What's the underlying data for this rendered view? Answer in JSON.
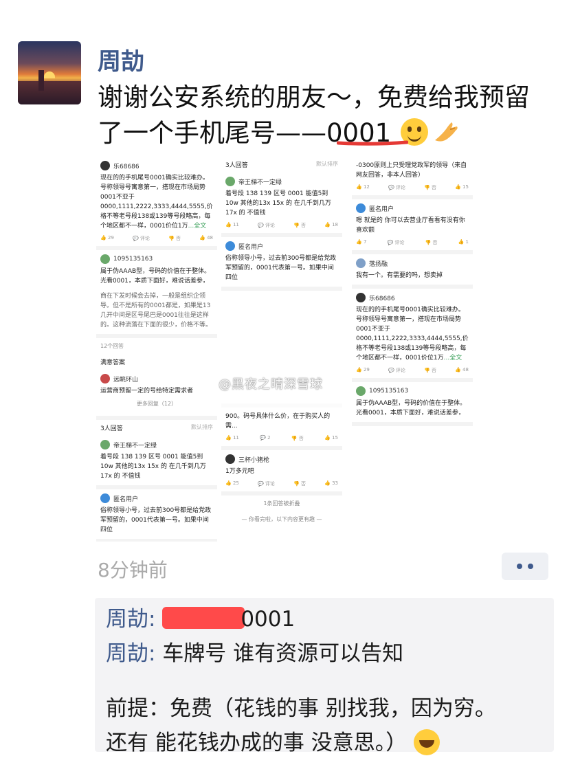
{
  "post": {
    "author": "周劼",
    "text_line1": "谢谢公安系统的朋友～，免费给我预留",
    "text_line2": "了一个手机尾号——0001",
    "time": "8分钟前"
  },
  "screens": {
    "col1": {
      "user1": "乐68686",
      "text1": "现在的的手机尾号0001确实比较难办。号称领导号寓意第一，搭现在市场局势0001不亚于0000,1111,2222,3333,4444,5555,价格不等老号段138或139等号段略高，每个地区都不一样，0001价位1万",
      "full": "...全文",
      "user2": "1095135163",
      "text2": "属于伪AAAB型，号码的价值在于整体。光看0001，本质下面好，难说话差参，",
      "text3": "商在下发时候会去掉，一般是组织企领导。但不是所有的0001都是，如果是13几开中间是区号尾巴是0001往往是这样的。这种流落在下面的很少，价格不等。",
      "reply_count": "12个回答",
      "sec_title": "满意答案",
      "user3": "远眺环山",
      "text4": "运营商预留一定的号给特定需求者",
      "more_link": "更多回复（12）",
      "sec2_title": "3人回答",
      "sort": "默认排序",
      "user4": "帝王梯不一定绿",
      "text5": "着号段 138 139 区号 0001 能值5到10w 其他的13x 15x 的 在几千到几万 17x 的 不值钱",
      "user5": "匿名用户",
      "text6": "俗称领导小号，过去前300号都是给党政军预留的，0001代表第一号。如果中间四位"
    },
    "col2": {
      "sec_title": "3人回答",
      "sort": "默认排序",
      "user1": "帝王梯不一定绿",
      "text1": "着号段 138 139 区号 0001 能值5到10w 其他的13x 15x 的 在几千到几万 17x 的 不值钱",
      "user2": "匿名用户",
      "text2": "俗称领导小号，过去前300号都是给党政军预留的，0001代表第一号。如果中间四位",
      "text3": "900。码号具体什么价，在于购买人的需...",
      "user3": "三杯小猪枪",
      "text4": "1万多元吧",
      "collapsed": "1条回答被折叠",
      "end": "— 你看完啦，以下内容更有趣 —"
    },
    "col3": {
      "text1": "-0300原则上只受理党政军的领导（来自网友回答，非本人回答）",
      "user1": "匿名用户",
      "text2": "嗯 就是的 你可以去营业厅看看有没有你喜欢额",
      "user2": "落扬融",
      "text3": "我有一个。有需要的吗，想卖掉",
      "user3": "乐68686",
      "text4": "现在的的手机尾号0001确实比较难办。号称领导号寓意第一，搭现在市场局势0001不亚于0000,1111,2222,3333,4444,5555,价格不等老号段138或139等号段略高，每个地区都不一样，0001价位1万",
      "full": "...全文",
      "user4": "1095135163",
      "text5": "属于伪AAAB型，号码的价值在于整体。光看0001，本质下面好，难说话差参，"
    },
    "watermark": "@黑夜之晴深雪球"
  },
  "comments": {
    "c1_name": "周劼",
    "c1_text": "0001",
    "c2_name": "周劼",
    "c2_text": "车牌号 谁有资源可以告知",
    "c3_line1": "前提：免费（花钱的事 别找我，因为穷。",
    "c3_line2": "还有 能花钱办成的事  没意思。）"
  },
  "colors": {
    "name_blue": "#3f5a8c",
    "underline_red": "#e53935"
  }
}
